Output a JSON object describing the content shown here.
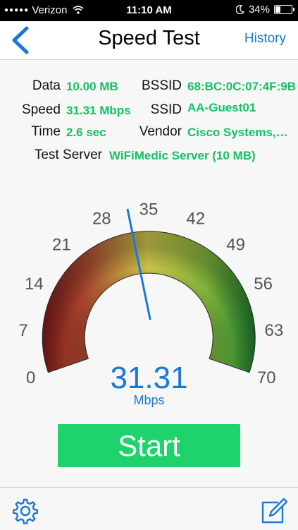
{
  "status_bar": {
    "carrier": "Verizon",
    "time": "11:10 AM",
    "battery": "34%",
    "icons": [
      "signal-dots-icon",
      "wifi-icon",
      "moon-icon",
      "battery-icon"
    ]
  },
  "nav": {
    "back_icon": "chevron-left-icon",
    "title": "Speed Test",
    "history_label": "History"
  },
  "results": {
    "data_label": "Data",
    "data_value": "10.00 MB",
    "speed_label": "Speed",
    "speed_value": "31.31 Mbps",
    "time_label": "Time",
    "time_value": "2.6 sec",
    "bssid_label": "BSSID",
    "bssid_value": "68:BC:0C:07:4F:9B",
    "ssid_label": "SSID",
    "ssid_value": "AA-Guest01",
    "vendor_label": "Vendor",
    "vendor_value": "Cisco Systems,…",
    "server_label": "Test Server",
    "server_value": "WiFiMedic Server (10 MB)"
  },
  "gauge": {
    "min": 0,
    "max": 70,
    "ticks": [
      "0",
      "7",
      "14",
      "21",
      "28",
      "35",
      "42",
      "49",
      "56",
      "63",
      "70"
    ],
    "value": 31.31,
    "value_text": "31.31",
    "unit": "Mbps",
    "colors": {
      "low": "#7a1a1a",
      "mid": "#c9c24a",
      "high": "#1f7d2e",
      "needle": "#1a78d8"
    }
  },
  "start_label": "Start",
  "toolbar": {
    "left_icon": "gear-icon",
    "right_icon": "compose-icon"
  },
  "colors": {
    "accent": "#1a78d8",
    "value_green": "#16c063",
    "button_green": "#1ed36b"
  }
}
